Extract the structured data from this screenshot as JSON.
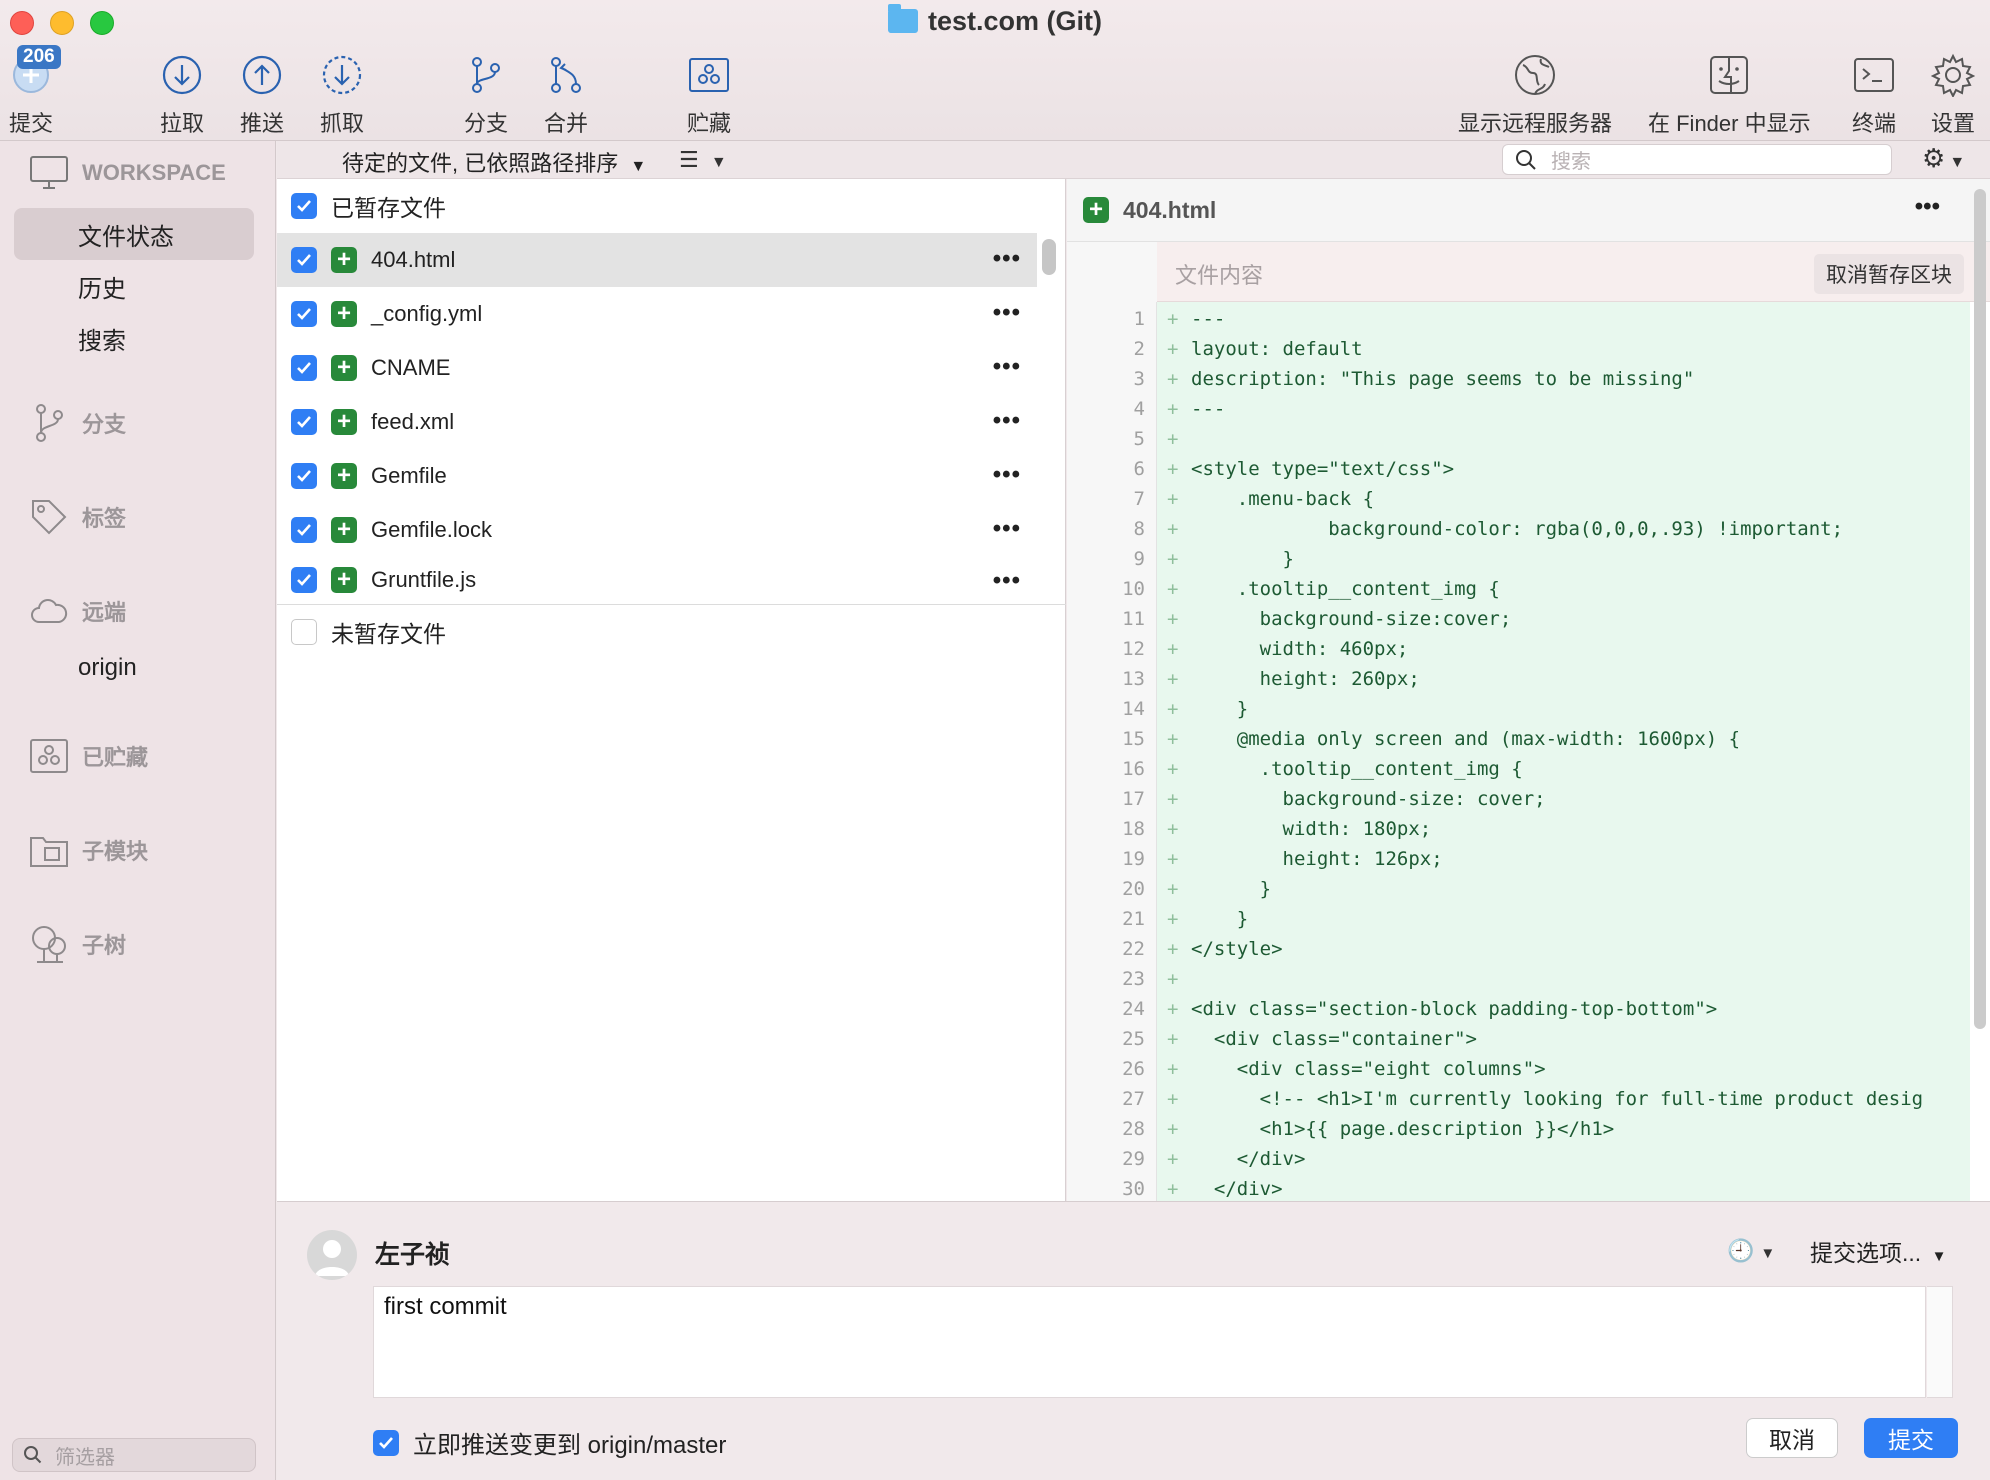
{
  "window": {
    "title": "test.com (Git)"
  },
  "toolbar": {
    "commit": {
      "label": "提交",
      "badge": "206"
    },
    "pull": "拉取",
    "push": "推送",
    "fetch": "抓取",
    "branch": "分支",
    "merge": "合并",
    "stash": "贮藏",
    "show_remote": "显示远程服务器",
    "show_in_finder": "在 Finder 中显示",
    "terminal": "终端",
    "settings": "设置"
  },
  "sidebar": {
    "workspace": "WORKSPACE",
    "workspace_items": [
      "文件状态",
      "历史",
      "搜索"
    ],
    "branches": "分支",
    "tags": "标签",
    "remotes": "远端",
    "remote_items": [
      "origin"
    ],
    "stashes": "已贮藏",
    "submodules": "子模块",
    "subtrees": "子树",
    "filter_placeholder": "筛选器"
  },
  "filebar": {
    "sort_label": "待定的文件, 已依照路径排序",
    "search_placeholder": "搜索"
  },
  "staged": {
    "header": "已暂存文件",
    "files": [
      "404.html",
      "_config.yml",
      "CNAME",
      "feed.xml",
      "Gemfile",
      "Gemfile.lock",
      "Gruntfile.js"
    ]
  },
  "unstaged": {
    "header": "未暂存文件"
  },
  "diff": {
    "file": "404.html",
    "hunk_label": "文件内容",
    "unstage_hunk": "取消暂存区块",
    "lines": [
      "---",
      "layout: default",
      "description: \"This page seems to be missing\"",
      "---",
      "",
      "<style type=\"text/css\">",
      "    .menu-back {",
      "            background-color: rgba(0,0,0,.93) !important;",
      "        }",
      "    .tooltip__content_img {",
      "      background-size:cover;",
      "      width: 460px;",
      "      height: 260px;",
      "    }",
      "    @media only screen and (max-width: 1600px) {",
      "      .tooltip__content_img {",
      "        background-size: cover;",
      "        width: 180px;",
      "        height: 126px;",
      "      }",
      "    }",
      "</style>",
      "",
      "<div class=\"section-block padding-top-bottom\">",
      "  <div class=\"container\">",
      "    <div class=\"eight columns\">",
      "      <!-- <h1>I'm currently looking for full-time product desig",
      "      <h1>{{ page.description }}</h1>",
      "    </div>",
      "  </div>"
    ]
  },
  "commit": {
    "author": "左子祯",
    "options": "提交选项...",
    "message": "first commit",
    "push_label": "立即推送变更到 origin/master",
    "cancel": "取消",
    "submit": "提交"
  },
  "colors": {
    "accent": "#2f7ef4",
    "added": "#28893a",
    "diff_bg": "#e8f8ee",
    "sidebar_bg": "#eee3e6"
  }
}
